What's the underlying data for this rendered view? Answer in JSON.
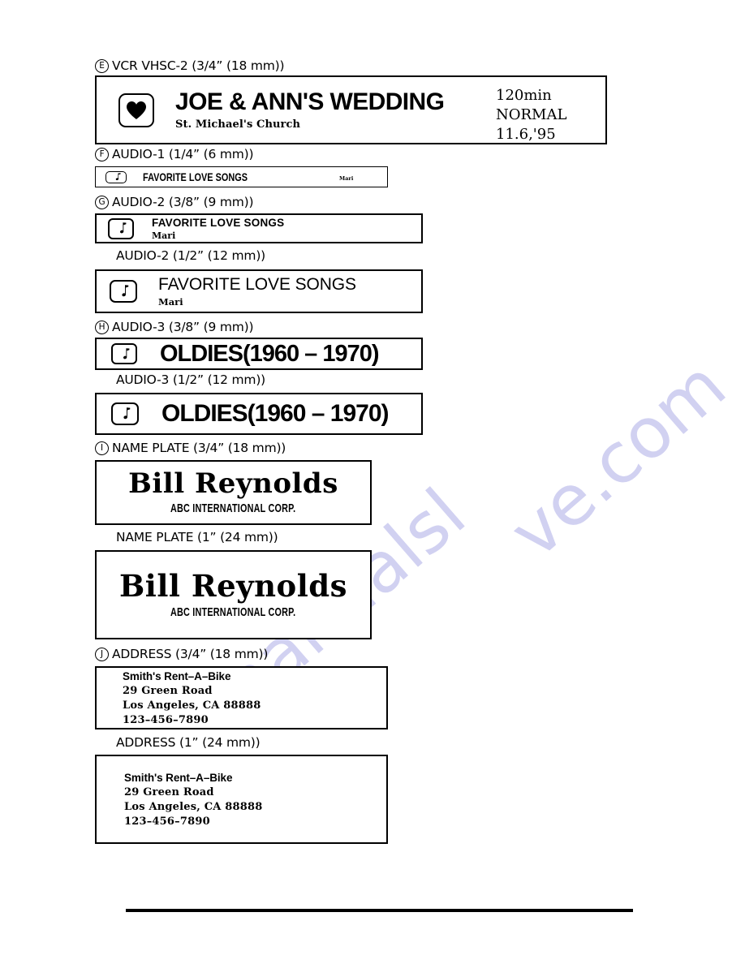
{
  "sections": [
    {
      "id": "vcr",
      "marker": "E",
      "caption": "VCR VHSC-2 (3/4” (18 mm))",
      "icon": "heart-icon",
      "title": "JOE & ANN'S WEDDING",
      "subtitle": "St. Michael's Church",
      "meta_lines": [
        "120min",
        "NORMAL",
        "11.6,'95"
      ]
    },
    {
      "id": "audio1",
      "marker": "F",
      "caption": "AUDIO-1 (1/4” (6 mm))",
      "icon": "music-note-icon",
      "title": "FAVORITE LOVE SONGS",
      "subtitle": "Mari"
    },
    {
      "id": "audio2_small",
      "marker": "G",
      "caption": "AUDIO-2 (3/8” (9 mm))",
      "icon": "music-note-icon",
      "title": "FAVORITE LOVE SONGS",
      "subtitle": "Mari"
    },
    {
      "id": "audio2_large",
      "marker": "",
      "caption": "AUDIO-2 (1/2” (12 mm))",
      "icon": "music-note-icon",
      "title": "FAVORITE LOVE SONGS",
      "subtitle": "Mari"
    },
    {
      "id": "audio3_small",
      "marker": "H",
      "caption": "AUDIO-3 (3/8” (9 mm))",
      "icon": "music-note-icon",
      "title": "OLDIES(1960 – 1970)"
    },
    {
      "id": "audio3_large",
      "marker": "",
      "caption": "AUDIO-3 (1/2” (12 mm))",
      "icon": "music-note-icon",
      "title": "OLDIES(1960 – 1970)"
    },
    {
      "id": "nameplate_small",
      "marker": "I",
      "caption": "NAME PLATE (3/4” (18 mm))",
      "title": "Bill Reynolds",
      "subtitle": "ABC INTERNATIONAL CORP."
    },
    {
      "id": "nameplate_large",
      "marker": "",
      "caption": "NAME PLATE (1” (24 mm))",
      "title": "Bill Reynolds",
      "subtitle": "ABC INTERNATIONAL CORP."
    },
    {
      "id": "address_small",
      "marker": "J",
      "caption": "ADDRESS (3/4” (18 mm))",
      "lines": [
        "Smith's Rent–A–Bike",
        "29 Green Road",
        "Los Angeles, CA 88888",
        "123–456–7890"
      ]
    },
    {
      "id": "address_large",
      "marker": "",
      "caption": "ADDRESS (1” (24 mm))",
      "lines": [
        "Smith's Rent–A–Bike",
        "29 Green Road",
        "Los Angeles, CA 88888",
        "123–456–7890"
      ]
    }
  ],
  "watermark": {
    "text_a": "manualsl",
    "text_b": "ve.com"
  },
  "colors": {
    "ink": "#000000",
    "paper": "#ffffff",
    "watermark": "#c9c9ef"
  }
}
